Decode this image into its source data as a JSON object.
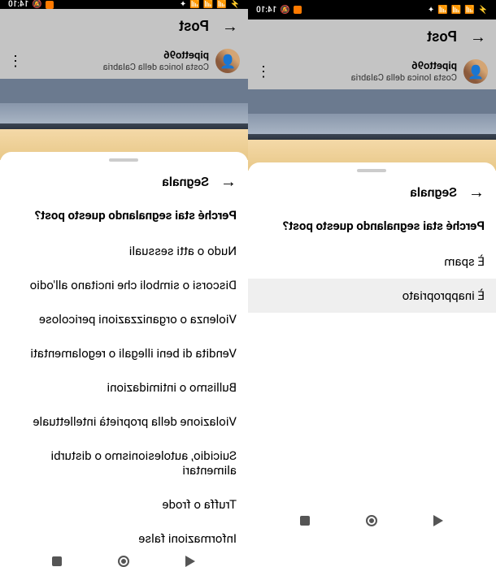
{
  "status": {
    "time": "14:10",
    "signal1": "📶",
    "signal2": "📶",
    "wifi": "📶",
    "battery": "🔋"
  },
  "post": {
    "title": "Post",
    "username": "pipetto96",
    "location": "Costa Ionica della Calabria"
  },
  "sheet": {
    "title": "Segnala",
    "question": "Perché stai segnalando questo post?"
  },
  "screens": [
    {
      "options": [
        {
          "label": "È spam",
          "highlighted": false
        },
        {
          "label": "È inappropriato",
          "highlighted": true
        }
      ]
    },
    {
      "options": [
        {
          "label": "Nudo o atti sessuali",
          "highlighted": false
        },
        {
          "label": "Discorsi o simboli che incitano all'odio",
          "highlighted": false
        },
        {
          "label": "Violenza o organizzazioni pericolose",
          "highlighted": false
        },
        {
          "label": "Vendita di beni illegali o regolamentati",
          "highlighted": false
        },
        {
          "label": "Bullismo o intimidazioni",
          "highlighted": false
        },
        {
          "label": "Violazione della proprietà intellettuale",
          "highlighted": false
        },
        {
          "label": "Suicidio, autolesionismo o disturbi alimentari",
          "highlighted": false
        },
        {
          "label": "Truffa o frode",
          "highlighted": false
        },
        {
          "label": "Informazioni false",
          "highlighted": false
        }
      ]
    }
  ]
}
